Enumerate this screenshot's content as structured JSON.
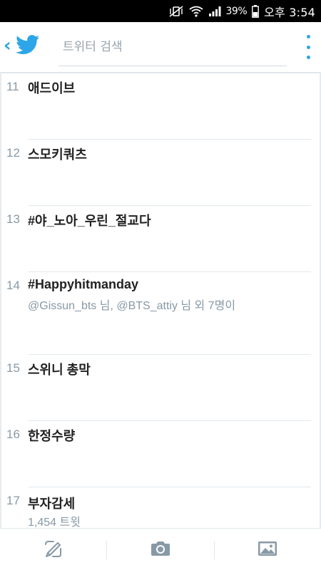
{
  "status_bar": {
    "battery_percent": "39%",
    "time": "오후 3:54",
    "icons": [
      "mute-vibrate-icon",
      "wifi-icon",
      "signal-icon",
      "battery-icon"
    ]
  },
  "header": {
    "back_icon": "chevron-left-icon",
    "logo": "twitter-bird-icon",
    "search": {
      "placeholder": "트위터 검색",
      "value": ""
    },
    "menu_icon": "overflow-menu-icon"
  },
  "colors": {
    "accent": "#2ca6e8",
    "rank": "#8899a6",
    "divider": "#e1e8ed",
    "toolbar_icon": "#8899a6"
  },
  "trends": [
    {
      "rank": "11",
      "name": "애드이브",
      "sub": ""
    },
    {
      "rank": "12",
      "name": "스모키쿼츠",
      "sub": ""
    },
    {
      "rank": "13",
      "name": "#야_노아_우린_절교다",
      "sub": ""
    },
    {
      "rank": "14",
      "name": "#Happyhitmanday",
      "sub": "@Gissun_bts 님, @BTS_attiy 님 외 7명이"
    },
    {
      "rank": "15",
      "name": "스위니 총막",
      "sub": ""
    },
    {
      "rank": "16",
      "name": "한정수량",
      "sub": ""
    },
    {
      "rank": "17",
      "name": "부자감세",
      "sub": "1,454 트윗"
    }
  ],
  "bottom_bar": {
    "items": [
      {
        "name": "compose-tweet-button",
        "icon": "compose-icon"
      },
      {
        "name": "camera-button",
        "icon": "camera-icon"
      },
      {
        "name": "gallery-button",
        "icon": "image-icon"
      }
    ]
  }
}
